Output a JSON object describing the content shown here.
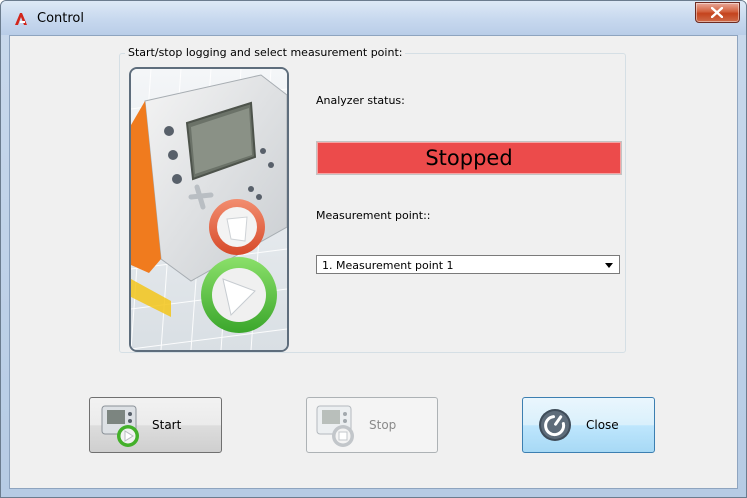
{
  "window": {
    "title": "Control",
    "close_glyph": "X"
  },
  "group": {
    "legend": "Start/stop logging and select measurement point:"
  },
  "status": {
    "label": "Analyzer status:",
    "value": "Stopped",
    "color": "#ec4b4b"
  },
  "measurement": {
    "label": "Measurement point::",
    "selected": "1. Measurement point 1"
  },
  "buttons": {
    "start": "Start",
    "stop": "Stop",
    "close": "Close"
  },
  "icons": {
    "app": "app-logo-icon",
    "window_close": "close-icon",
    "illustration": "analyzer-device-illustration",
    "start": "analyzer-play-icon",
    "stop": "analyzer-stop-icon",
    "close": "power-icon",
    "dropdown": "chevron-down-icon"
  }
}
